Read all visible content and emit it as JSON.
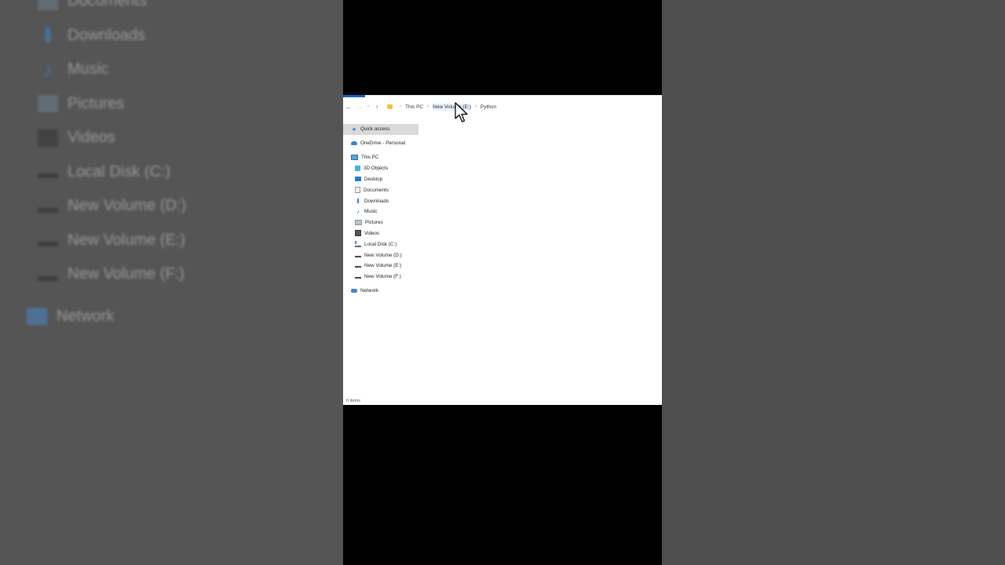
{
  "background_list": [
    {
      "label": "Documents",
      "icon": "documents-icon"
    },
    {
      "label": "Downloads",
      "icon": "downloads-icon"
    },
    {
      "label": "Music",
      "icon": "music-icon"
    },
    {
      "label": "Pictures",
      "icon": "pictures-icon"
    },
    {
      "label": "Videos",
      "icon": "videos-icon"
    },
    {
      "label": "Local Disk (C:)",
      "icon": "local-disk-icon"
    },
    {
      "label": "New Volume (D:)",
      "icon": "drive-icon"
    },
    {
      "label": "New Volume (E:)",
      "icon": "drive-icon"
    },
    {
      "label": "New Volume (F:)",
      "icon": "drive-icon"
    },
    {
      "label": "Network",
      "icon": "network-icon"
    }
  ],
  "address": {
    "crumbs": [
      "This PC",
      "New Volume (E:)",
      "Python"
    ]
  },
  "nav": {
    "quick_access": "Quick access",
    "onedrive": "OneDrive - Personal",
    "this_pc": "This PC",
    "items": [
      "3D Objects",
      "Desktop",
      "Documents",
      "Downloads",
      "Music",
      "Pictures",
      "Videos",
      "Local Disk (C:)",
      "New Volume (D:)",
      "New Volume (E:)",
      "New Volume (F:)"
    ],
    "network": "Network"
  },
  "status": {
    "items_count": "0 items"
  },
  "colors": {
    "accent": "#0a64c8",
    "selected_bg": "#d9d9d9",
    "letterbox": "#000000"
  }
}
